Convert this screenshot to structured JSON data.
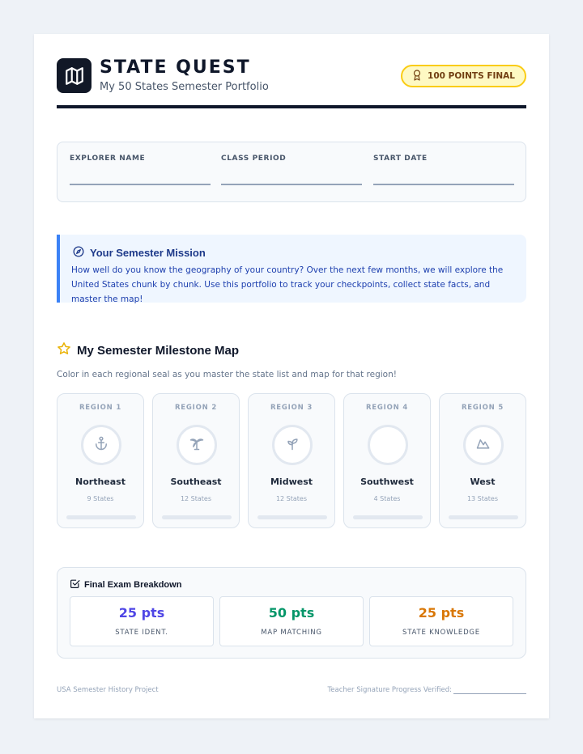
{
  "header": {
    "title": "STATE QUEST",
    "subtitle": "My 50 States Semester Portfolio",
    "badge": "100 POINTS FINAL",
    "logo_icon": "map-icon",
    "badge_icon": "award-icon"
  },
  "info_fields": [
    {
      "label": "EXPLORER NAME",
      "value": ""
    },
    {
      "label": "CLASS PERIOD",
      "value": ""
    },
    {
      "label": "START DATE",
      "value": ""
    }
  ],
  "mission": {
    "icon": "compass-icon",
    "title": "Your Semester Mission",
    "text": "How well do you know the geography of your country? Over the next few months, we will explore the United States chunk by chunk. Use this portfolio to track your checkpoints, collect state facts, and master the map!"
  },
  "milestones": {
    "icon": "star-icon",
    "heading": "My Semester Milestone Map",
    "description": "Color in each regional seal as you master the state list and map for that region!",
    "regions": [
      {
        "label": "REGION 1",
        "name": "Northeast",
        "count": "9 States",
        "icon": "anchor-icon",
        "progress": 0
      },
      {
        "label": "REGION 2",
        "name": "Southeast",
        "count": "12 States",
        "icon": "palm-tree-icon",
        "progress": 0
      },
      {
        "label": "REGION 3",
        "name": "Midwest",
        "count": "12 States",
        "icon": "sprout-icon",
        "progress": 0
      },
      {
        "label": "REGION 4",
        "name": "Southwest",
        "count": "4 States",
        "icon": "sun-icon",
        "progress": 0
      },
      {
        "label": "REGION 5",
        "name": "West",
        "count": "13 States",
        "icon": "mountain-icon",
        "progress": 0
      }
    ]
  },
  "exam": {
    "icon": "checkbox-icon",
    "title": "Final Exam Breakdown",
    "items": [
      {
        "points": "25 pts",
        "label": "STATE IDENT.",
        "color": "#4f46e5"
      },
      {
        "points": "50 pts",
        "label": "MAP MATCHING",
        "color": "#059669"
      },
      {
        "points": "25 pts",
        "label": "STATE KNOWLEDGE",
        "color": "#d97706"
      }
    ]
  },
  "footer": {
    "left": "USA Semester History Project",
    "right": "Teacher Signature Progress Verified:"
  },
  "colors": {
    "accent": "#3b82f6",
    "badge_bg": "#fef9c3",
    "badge_border": "#facc15",
    "dark": "#0f172a"
  }
}
